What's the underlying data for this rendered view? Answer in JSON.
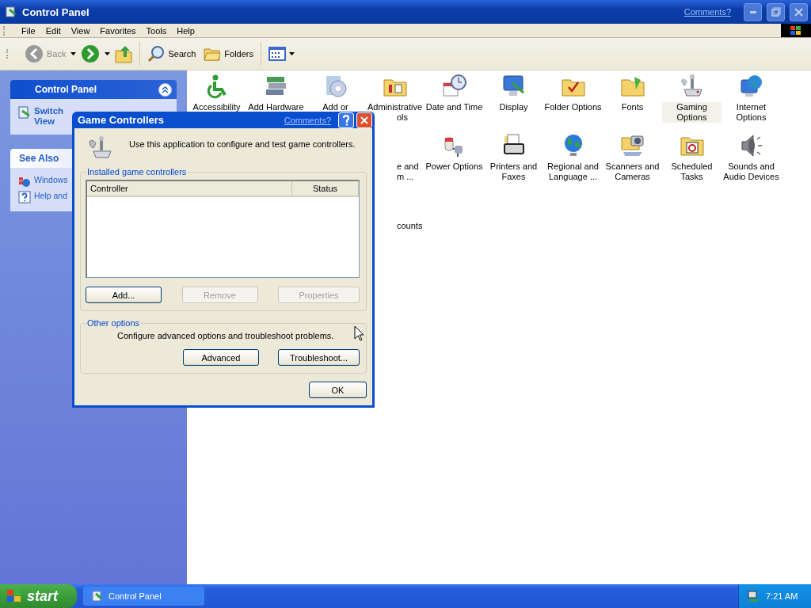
{
  "window": {
    "title": "Control Panel",
    "comments_link": "Comments?"
  },
  "menu": [
    "File",
    "Edit",
    "View",
    "Favorites",
    "Tools",
    "Help"
  ],
  "toolbar": {
    "back": {
      "label": "Back",
      "disabled": true
    },
    "search": "Search",
    "folders": "Folders"
  },
  "sidebar": {
    "panels": [
      {
        "title": "Control Panel",
        "expanded": true,
        "links": [
          "Switch\nView"
        ]
      },
      {
        "title": "See Also",
        "links": [
          "Windows",
          "Help and"
        ]
      }
    ]
  },
  "icons": {
    "rows": [
      [
        {
          "kind": "icon",
          "selected": false,
          "lines": [
            {
              "text": "Accessibility",
              "cut": false
            }
          ]
        },
        {
          "kind": "icon",
          "selected": false,
          "lines": [
            {
              "text": "Add Hardware",
              "cut": false
            }
          ]
        },
        {
          "kind": "icon",
          "selected": false,
          "lines": [
            {
              "text": "Add or",
              "cut": false
            }
          ]
        },
        {
          "kind": "icon",
          "selected": false,
          "lines": [
            {
              "text": "Administrative",
              "cut": false
            },
            {
              "text": "ols",
              "cut": true
            }
          ]
        },
        {
          "kind": "icon",
          "selected": false,
          "lines": [
            {
              "text": "Date and Time",
              "cut": false
            }
          ]
        },
        {
          "kind": "icon",
          "selected": false,
          "lines": [
            {
              "text": "Display",
              "cut": false
            }
          ]
        },
        {
          "kind": "icon",
          "selected": false,
          "lines": [
            {
              "text": "Folder Options",
              "cut": false
            }
          ]
        },
        {
          "kind": "icon",
          "selected": false,
          "lines": [
            {
              "text": "Fonts",
              "cut": false
            }
          ]
        },
        {
          "kind": "icon",
          "selected": true,
          "lines": [
            {
              "text": "Gaming",
              "cut": false
            },
            {
              "text": "Options",
              "cut": false
            }
          ]
        },
        {
          "kind": "icon",
          "selected": false,
          "lines": [
            {
              "text": "Internet",
              "cut": false
            },
            {
              "text": "Options",
              "cut": false
            }
          ]
        }
      ],
      [
        "",
        "",
        "",
        {
          "kind": "text-only",
          "selected": false,
          "lines": [
            {
              "text": "e and",
              "cut": true
            },
            {
              "text": "m ...",
              "cut": true
            }
          ]
        },
        {
          "kind": "icon",
          "selected": false,
          "lines": [
            {
              "text": "Power Options",
              "cut": false
            }
          ]
        },
        {
          "kind": "icon",
          "selected": false,
          "lines": [
            {
              "text": "Printers and",
              "cut": false
            },
            {
              "text": "Faxes",
              "cut": false
            }
          ]
        },
        {
          "kind": "icon",
          "selected": false,
          "lines": [
            {
              "text": "Regional and",
              "cut": false
            },
            {
              "text": "Language ...",
              "cut": false
            }
          ]
        },
        {
          "kind": "icon",
          "selected": false,
          "lines": [
            {
              "text": "Scanners and",
              "cut": false
            },
            {
              "text": "Cameras",
              "cut": false
            }
          ]
        },
        {
          "kind": "icon",
          "selected": false,
          "lines": [
            {
              "text": "Scheduled",
              "cut": false
            },
            {
              "text": "Tasks",
              "cut": false
            }
          ]
        },
        {
          "kind": "icon",
          "selected": false,
          "lines": [
            {
              "text": "Sounds and",
              "cut": false
            },
            {
              "text": "Audio Devices",
              "cut": false
            }
          ]
        }
      ],
      [
        "",
        "",
        "",
        {
          "kind": "text-only",
          "selected": false,
          "lines": [
            {
              "text": "counts",
              "cut": true
            }
          ]
        }
      ]
    ]
  },
  "dialog": {
    "title": "Game Controllers",
    "comments_link": "Comments?",
    "intro": "Use this application to configure and test game controllers.",
    "installed_group": {
      "legend": "Installed game controllers",
      "columns": [
        "Controller",
        "Status"
      ],
      "buttons": [
        {
          "label": "Add...",
          "disabled": false
        },
        {
          "label": "Remove",
          "disabled": true
        },
        {
          "label": "Properties",
          "disabled": true
        }
      ]
    },
    "other_group": {
      "legend": "Other options",
      "text": "Configure advanced options and troubleshoot problems.",
      "buttons": [
        {
          "label": "Advanced",
          "disabled": false
        },
        {
          "label": "Troubleshoot...",
          "disabled": false
        }
      ]
    },
    "ok": "OK"
  },
  "taskbar": {
    "start": "start",
    "tasks": [
      {
        "label": "Control Panel",
        "selected": false
      }
    ],
    "clock": "7:21 AM"
  }
}
